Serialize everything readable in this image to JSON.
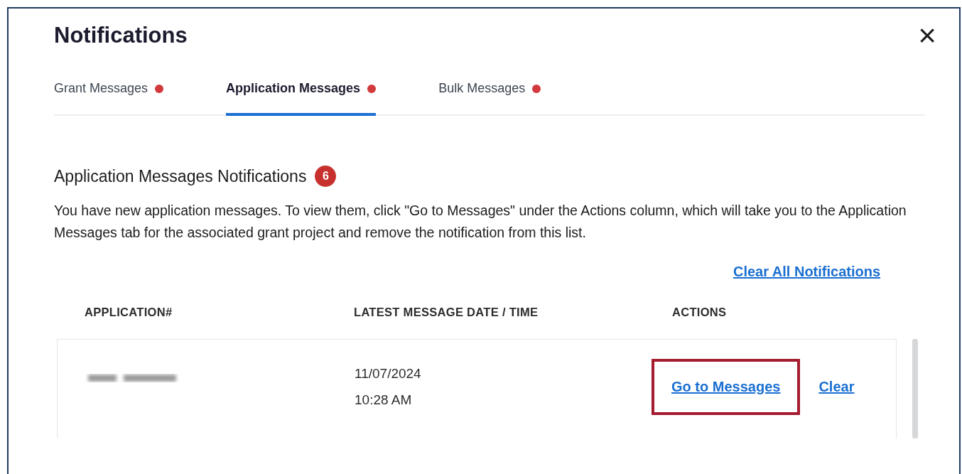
{
  "dialog": {
    "title": "Notifications",
    "close_label": "×"
  },
  "tabs": [
    {
      "label": "Grant Messages",
      "selected": false,
      "has_new": true
    },
    {
      "label": "Application Messages",
      "selected": true,
      "has_new": true
    },
    {
      "label": "Bulk Messages",
      "selected": false,
      "has_new": true
    }
  ],
  "section": {
    "heading": "Application Messages Notifications",
    "count": "6",
    "description": "You have new application messages. To view them, click \"Go to Messages\" under the Actions column, which will take you to the Application Messages tab for the associated grant project and remove the notification from this list.",
    "clear_all": "Clear All Notifications"
  },
  "table": {
    "columns": [
      "APPLICATION#",
      "LATEST MESSAGE DATE / TIME",
      "ACTIONS"
    ],
    "rows": [
      {
        "application_blurred": true,
        "date": "11/07/2024",
        "time": "10:28 AM",
        "actions": [
          {
            "label": "Go to Messages",
            "highlighted": true
          },
          {
            "label": "Clear",
            "highlighted": false
          }
        ]
      }
    ]
  }
}
